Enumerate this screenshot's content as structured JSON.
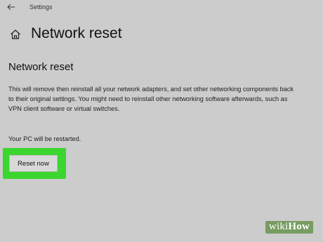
{
  "window": {
    "title": "Settings"
  },
  "page": {
    "title": "Network reset"
  },
  "section": {
    "title": "Network reset",
    "description": "This will remove then reinstall all your network adapters, and set other networking components back to their original settings. You might need to reinstall other networking software afterwards, such as VPN client software or virtual switches.",
    "restart_note": "Your PC will be restarted."
  },
  "actions": {
    "reset_label": "Reset now"
  },
  "highlight_color": "#3bd62f",
  "watermark": {
    "prefix": "wiki",
    "suffix": "How"
  },
  "icons": {
    "back": "back-arrow-icon",
    "home": "home-icon"
  }
}
